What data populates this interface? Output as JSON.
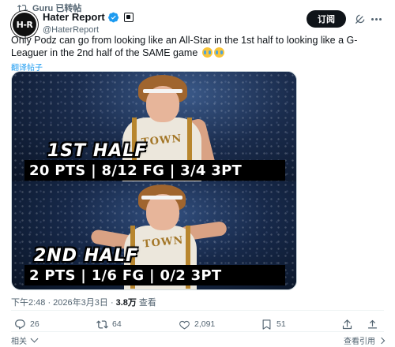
{
  "repost": {
    "text": "Guru 已转帖"
  },
  "author": {
    "avatar_text": "H-R",
    "name": "Hater Report",
    "handle": "@HaterReport"
  },
  "subscribe_label": "订阅",
  "tweet": {
    "text": "Only Podz can go from looking like an All-Star in the 1st half to looking like a G-Leaguer in the 2nd half of the SAME game",
    "translate": "翻译帖子"
  },
  "media": {
    "first_half_label": "1ST HALF",
    "first_half_stats": "20 PTS | 8/12 FG | 3/4 3PT",
    "second_half_label": "2ND HALF",
    "second_half_stats": "2 PTS | 1/6 FG | 0/2 3PT",
    "jersey_text": "TOWN"
  },
  "meta": {
    "time": "下午2:48 · 2026年3月3日 ·",
    "views": "3.8万",
    "views_label": "查看"
  },
  "actions": {
    "replies": "26",
    "reposts": "64",
    "likes": "2,091",
    "bookmarks": "51"
  },
  "footer": {
    "related": "相关",
    "quotes": "查看引用"
  },
  "colors": {
    "accent": "#1d9bf0",
    "text": "#0f1419",
    "muted": "#536471"
  }
}
